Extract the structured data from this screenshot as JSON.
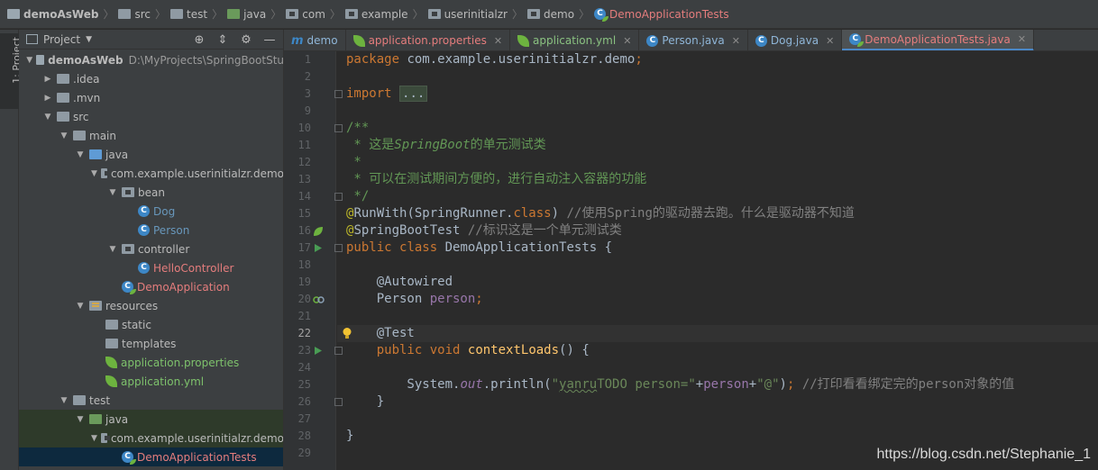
{
  "breadcrumb": [
    "demoAsWeb",
    "src",
    "test",
    "java",
    "com",
    "example",
    "userinitialzr",
    "demo",
    "DemoApplicationTests"
  ],
  "stripe": {
    "project_label": "1: Project"
  },
  "project_panel": {
    "title": "Project",
    "tools": {
      "locate": "⊕",
      "collapse": "⇕",
      "settings": "⚙",
      "hide": "—"
    },
    "tree": [
      {
        "label": "demoAsWeb",
        "path": "D:\\MyProjects\\SpringBootStu",
        "level": 0,
        "expanded": "▼",
        "icon": "project-folder-icon"
      },
      {
        "label": ".idea",
        "level": 1,
        "expanded": "▶",
        "icon": "folder-icon"
      },
      {
        "label": ".mvn",
        "level": 1,
        "expanded": "▶",
        "icon": "folder-icon"
      },
      {
        "label": "src",
        "level": 1,
        "expanded": "▼",
        "icon": "folder-icon"
      },
      {
        "label": "main",
        "level": 2,
        "expanded": "▼",
        "icon": "folder-icon"
      },
      {
        "label": "java",
        "level": 3,
        "expanded": "▼",
        "icon": "source-folder-icon"
      },
      {
        "label": "com.example.userinitialzr.demo",
        "level": 4,
        "expanded": "▼",
        "icon": "package-icon"
      },
      {
        "label": "bean",
        "level": 5,
        "expanded": "▼",
        "icon": "package-icon"
      },
      {
        "label": "Dog",
        "level": 6,
        "expanded": "",
        "icon": "class-icon"
      },
      {
        "label": "Person",
        "level": 6,
        "expanded": "",
        "icon": "class-icon"
      },
      {
        "label": "controller",
        "level": 5,
        "expanded": "▼",
        "icon": "package-icon"
      },
      {
        "label": "HelloController",
        "level": 6,
        "expanded": "",
        "icon": "class-icon"
      },
      {
        "label": "DemoApplication",
        "level": 5,
        "expanded": "",
        "icon": "spring-class-icon"
      },
      {
        "label": "resources",
        "level": 3,
        "expanded": "▼",
        "icon": "resources-folder-icon"
      },
      {
        "label": "static",
        "level": 4,
        "expanded": "",
        "icon": "folder-icon"
      },
      {
        "label": "templates",
        "level": 4,
        "expanded": "",
        "icon": "folder-icon"
      },
      {
        "label": "application.properties",
        "level": 4,
        "expanded": "",
        "icon": "spring-leaf-icon"
      },
      {
        "label": "application.yml",
        "level": 4,
        "expanded": "",
        "icon": "spring-leaf-icon"
      },
      {
        "label": "test",
        "level": 2,
        "expanded": "▼",
        "icon": "folder-icon"
      },
      {
        "label": "java",
        "level": 3,
        "expanded": "▼",
        "icon": "test-folder-icon"
      },
      {
        "label": "com.example.userinitialzr.demo",
        "level": 4,
        "expanded": "▼",
        "icon": "package-icon"
      },
      {
        "label": "DemoApplicationTests",
        "level": 5,
        "expanded": "",
        "icon": "spring-class-icon"
      }
    ]
  },
  "tabs": [
    {
      "label": "demo",
      "icon": "maven-icon",
      "closable": false,
      "active": false
    },
    {
      "label": "application.properties",
      "icon": "spring-leaf-icon",
      "closable": true,
      "active": false
    },
    {
      "label": "application.yml",
      "icon": "spring-leaf-icon",
      "closable": true,
      "active": false
    },
    {
      "label": "Person.java",
      "icon": "class-icon",
      "closable": true,
      "active": false
    },
    {
      "label": "Dog.java",
      "icon": "class-icon",
      "closable": true,
      "active": false
    },
    {
      "label": "DemoApplicationTests.java",
      "icon": "spring-class-icon",
      "closable": true,
      "active": true
    }
  ],
  "editor": {
    "current_line": 22,
    "line_numbers": [
      "1",
      "2",
      "3",
      "9",
      "10",
      "11",
      "12",
      "13",
      "14",
      "15",
      "16",
      "17",
      "18",
      "19",
      "20",
      "21",
      "22",
      "23",
      "24",
      "25",
      "26",
      "27",
      "28",
      "29"
    ],
    "gutter_marks": {
      "16": "spring-bean-icon",
      "17": "run-gutter-icon",
      "20": "autowired-gutter-icon",
      "23": "run-gutter-icon"
    },
    "lines": [
      {
        "t": "package com.example.userinitialzr.demo;"
      },
      {
        "t": ""
      },
      {
        "t": "import ..."
      },
      {
        "t": ""
      },
      {
        "t": "/**"
      },
      {
        "t": " * 这是SpringBoot的单元测试类"
      },
      {
        "t": " *"
      },
      {
        "t": " * 可以在测试期间方便的，进行自动注入容器的功能"
      },
      {
        "t": " */"
      },
      {
        "t": "@RunWith(SpringRunner.class) //使用Spring的驱动器去跑。什么是驱动器不知道"
      },
      {
        "t": "@SpringBootTest //标识这是一个单元测试类"
      },
      {
        "t": "public class DemoApplicationTests {"
      },
      {
        "t": ""
      },
      {
        "t": "    @Autowired"
      },
      {
        "t": "    Person person;"
      },
      {
        "t": ""
      },
      {
        "t": "    @Test"
      },
      {
        "t": "    public void contextLoads() {"
      },
      {
        "t": ""
      },
      {
        "t": "        System.out.println(\"yanruTODO person=\"+person+\"@\"); //打印看看绑定完的person对象的值"
      },
      {
        "t": "    }"
      },
      {
        "t": ""
      },
      {
        "t": "}"
      },
      {
        "t": ""
      }
    ]
  },
  "watermark": "https://blog.csdn.net/Stephanie_1",
  "colors": {
    "background": "#2b2b2b",
    "panel": "#3c3f41",
    "keyword": "#cc7832",
    "annotation": "#bbb529",
    "string": "#6a8759",
    "doc": "#629755",
    "field": "#9876aa",
    "method": "#ffc66d",
    "accent": "#4a88c7"
  }
}
